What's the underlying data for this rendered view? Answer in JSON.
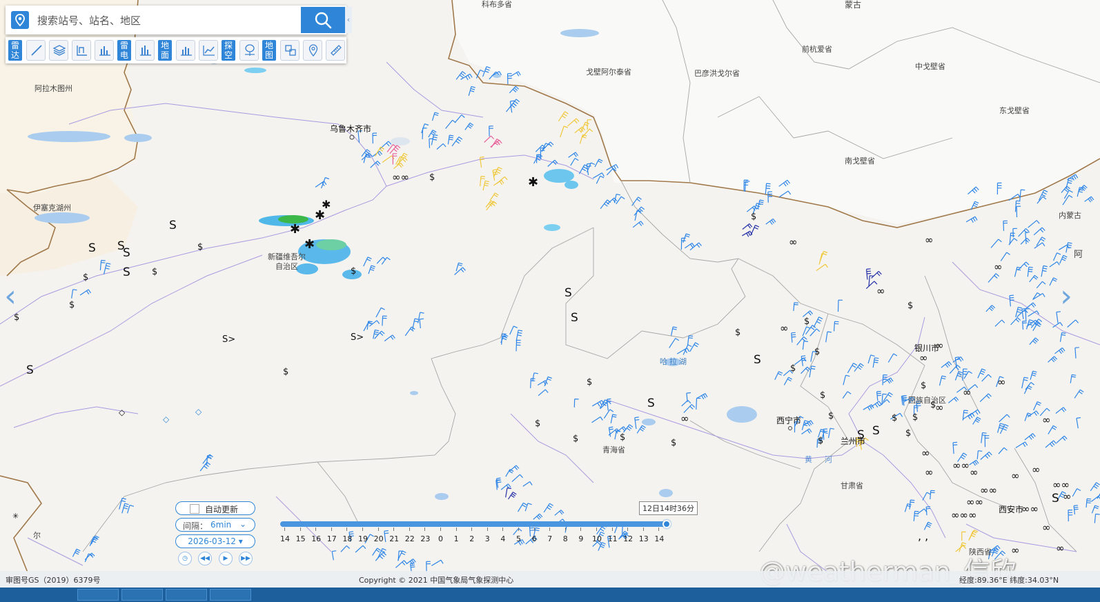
{
  "search": {
    "placeholder": "搜索站号、站名、地区",
    "collapse_glyph": "‹"
  },
  "toolbar": {
    "radar_label": "雷达",
    "lightning_label": "雷电",
    "surface_label": "地面",
    "sounding_label": "探空",
    "map_label": "地图"
  },
  "map_labels": {
    "regions": [
      {
        "id": "kobdo",
        "text": "科布多省"
      },
      {
        "id": "mongolia",
        "text": "蒙古"
      },
      {
        "id": "qianhangai",
        "text": "前杭爱省"
      },
      {
        "id": "zhonggobi",
        "text": "中戈壁省"
      },
      {
        "id": "gobialtai",
        "text": "戈壁阿尔泰省"
      },
      {
        "id": "bayankhongor",
        "text": "巴彦洪戈尔省"
      },
      {
        "id": "dongobi",
        "text": "东戈壁省"
      },
      {
        "id": "nangobi",
        "text": "南戈壁省"
      },
      {
        "id": "almaty",
        "text": "阿拉木图州"
      },
      {
        "id": "issykkul",
        "text": "伊塞克湖州"
      },
      {
        "id": "xinjiang",
        "text": "新疆维吾尔\n自治区"
      },
      {
        "id": "qinghai",
        "text": "青海省"
      },
      {
        "id": "gansu",
        "text": "甘肃省"
      },
      {
        "id": "shaanxi",
        "text": "陕西省"
      },
      {
        "id": "neimenggu",
        "text": "内蒙古"
      },
      {
        "id": "ningxia",
        "text": "回族自治区"
      },
      {
        "id": "er",
        "text": "尔"
      },
      {
        "id": "a",
        "text": "阿"
      }
    ],
    "cities": [
      {
        "id": "urumqi",
        "text": "乌鲁木齐市"
      },
      {
        "id": "xining",
        "text": "西宁市"
      },
      {
        "id": "lanzhou",
        "text": "兰州市"
      },
      {
        "id": "yinchuan",
        "text": "银川市"
      },
      {
        "id": "xian",
        "text": "西安市"
      }
    ],
    "lake": "哈拉湖",
    "river": "黄河"
  },
  "time_controls": {
    "auto_update_label": "自动更新",
    "interval_label": "间隔：",
    "interval_value": "6min",
    "date": "2026-03-12",
    "current_time": "12日14时36分"
  },
  "timeline": {
    "ticks": [
      "14",
      "15",
      "16",
      "17",
      "18",
      "19",
      "20",
      "21",
      "22",
      "23",
      "0",
      "1",
      "2",
      "3",
      "4",
      "5",
      "6",
      "7",
      "8",
      "9",
      "10",
      "11",
      "12",
      "13",
      "14"
    ],
    "progress": 1.0
  },
  "footer": {
    "license": "审图号GS（2019）6379号",
    "copyright": "Copyright © 2021 中国气象局气象探测中心",
    "coordinates": "经度:89.36°E 纬度:34.03°N"
  },
  "watermark": "@weatherman_信欣",
  "colors": {
    "accent": "#2f86d8",
    "barb_blue": "#2f86e8",
    "barb_yellow": "#f0c83c",
    "barb_pink": "#e8609a",
    "barb_navy": "#2430a8",
    "border_brown": "#a0784a",
    "border_gray": "#9a9a9a",
    "river": "#a99ae0",
    "lake": "#a9ccef"
  }
}
